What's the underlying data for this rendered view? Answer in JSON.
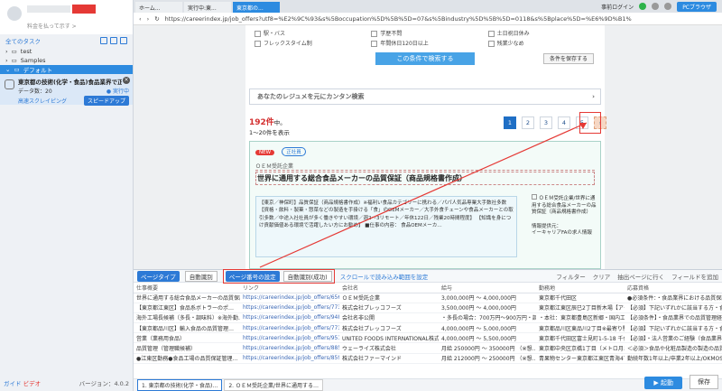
{
  "sidebar": {
    "sub": "料金を払って示す >",
    "all_tasks": "全てのタスク",
    "tree": [
      "test",
      "Samples",
      "デフォルト"
    ],
    "task": {
      "title": "東京都の技術(化学・食品)食品業界で正社員を探す",
      "count_label": "データ数：20",
      "status": "● 実行中",
      "mode": "高速スクレイピング",
      "speed": "スピードアップ"
    },
    "footer": {
      "tour": "ガイド",
      "video": "ビデオ",
      "version": "バージョン：4.0.2"
    }
  },
  "browser": {
    "tabs": [
      "ホーム...",
      "実行中:東...",
      "東京都の..."
    ],
    "login": "事前ログイン",
    "pc_mode": "PCブラウザ",
    "url": "https://careerindex.jp/job_offers?utf8=%E2%9C%93&s%5Boccupation%5D%5B%5D=07&s%5Bindustry%5D%5B%5D=0118&s%5Bplace%5D=%E6%9D%B1%"
  },
  "page": {
    "conditions": [
      "駅・バス",
      "学歴不問",
      "土日祝日休み",
      "フレックスタイム制",
      "年間休日120日以上",
      "残業少なめ"
    ],
    "search_btn": "この条件で検索する",
    "save_btn": "条件を保存する",
    "resume": "あなたのレジュメを元にカンタン検索",
    "count_num": "192件",
    "count_suffix": "中。",
    "count_range": "1〜20件を表示",
    "pages": [
      "1",
      "2",
      "3",
      "4",
      "5",
      "›"
    ],
    "job": {
      "new": "NEW",
      "tag": "正社員",
      "company": "ＯＥＭ受託企業",
      "title": "世界に通用する総合食品メーカーの品質保証（商品規格書作成）",
      "body": "【東京／神保町】品質保証（商品規格書作成）※福利い食品カテゴリーに携わる／パパ人気品専業大手数社多数 【資格・飲料・製菓・惣菜などの製造を手掛ける「食」のOEMメーカー／大手外食チェーンや食品メーカーとの取引多数／中途入社社員が多く働きやすい環境／週2〜3リモート／年休122日／残業20時間程度】 【知識を身につけ貢献価値ある環境で活躍したい方にお勧め】 ■仕事の内容： 食品OEMメーカ…",
      "img_alt": "ＯＥＭ受託企業/世界に通用する総合食品メーカーの品質保証（商品規格書作成）",
      "provider": "情報提供元：",
      "provider_name": "イーキャリアFAの求人情報"
    }
  },
  "bottom": {
    "type_label": "ページタイプ",
    "type_val": "自動識別",
    "pager_label": "ページ番号の設定",
    "pager_val": "自動識別(成功)",
    "scroll_link": "スクロールで読み込み範囲を設定",
    "filter": "フィルター",
    "clear": "クリア",
    "export": "抽出ページに行く",
    "add_field": "フィールドを追加",
    "columns": [
      "仕事概要",
      "リンク",
      "会社名",
      "給与",
      "勤務地",
      "応募資格"
    ],
    "rows": [
      [
        "世界に通用する総合食品メーカーの品質保証…",
        "https://careerindex.jp/job_offers/65638037",
        "ＯＥＭ受託企業",
        "3,000,000円 〜 4,000,000円",
        "東京都千代田区",
        "●必須条件：・食品業界における品質保証…"
      ],
      [
        "【東京都江東区】食品系ボトラーのポ…",
        "https://careerindex.jp/job_offers/77342677",
        "株式会社プレッコフーズ",
        "3,500,000円 〜 4,000,000円",
        "東京都江東区辰巳2丁目新木場【アクセス】…",
        "【必須】下記いずれかに該当する方・食品…"
      ],
      [
        "海外工場長候補（多長・調味料）※海外勤…",
        "https://careerindex.jp/job_offers/94885962",
        "会社名非公開",
        "・多長の場合：700万円〜900万円・調味料…",
        "・本社：東京都豊島区新郷・国内工場所在地…",
        "【必須条件】・食品業界での品質管理経験…"
      ],
      [
        "【東京都品川区】輸入食品の品質管理…",
        "https://careerindex.jp/job_offers/77342711",
        "株式会社プレッコフーズ",
        "4,000,000円 〜 5,000,000円",
        "東京都品川区東品川2丁目※最寄り駅：天…",
        "【必須】下記いずれかに該当する方・食品…"
      ],
      [
        "営業（業務用食品）",
        "https://careerindex.jp/job_offers/95157464",
        "UNITED FOODS INTERNATIONAL株式会社",
        "4,000,000円 〜 5,500,000円",
        "東京都千代田区富士見町1-5-18 千代田区…",
        "【必須】・法人営業のご経験（食品業界…"
      ],
      [
        "品質管理（管理職候補）",
        "https://careerindex.jp/job_offers/88505143",
        "ウェーライズ株式会社",
        "月給 250000円 〜 350000円 （※想…",
        "東京都中央区京橋1丁目（メトロ月島駅 日…",
        "＜必須＞食品や化粧品製造の製造の品質…"
      ],
      [
        "●江東区勤務●食品工場の品質保証管理…",
        "https://careerindex.jp/job_offers/85937906",
        "株式会社ファーマインド",
        "月給 212000円 〜 250000円 （※想…",
        "青果物センター東京都江東区青海4丁目7番4…",
        "勤続年数1年以上/卒業2年以上/OKMOS Excelを含む"
      ]
    ],
    "ctabs": [
      "1. 東京都の技術(化学・食品)…",
      "2. ＯＥＭ受託企業/世界に通用する…"
    ],
    "run": "▶ 起動",
    "save": "保存"
  }
}
